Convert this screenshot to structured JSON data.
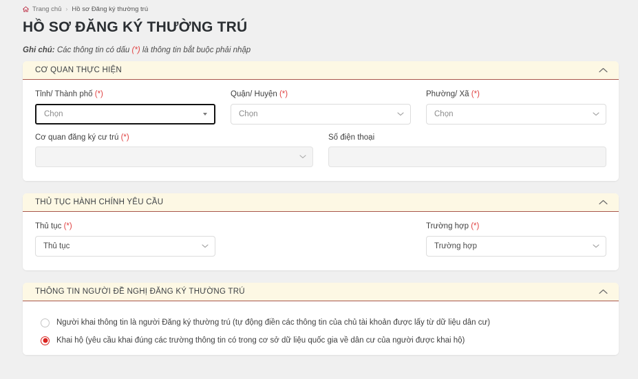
{
  "breadcrumb": {
    "home_icon": "home-icon",
    "home_label": "Trang chủ",
    "separator": "›",
    "current_label": "Hồ sơ Đăng ký thường trú"
  },
  "page_title": "HỒ SƠ ĐĂNG KÝ THƯỜNG TRÚ",
  "note": {
    "prefix": "Ghi chú:",
    "text_before": " Các thông tin có dấu ",
    "required_mark": "(*)",
    "text_after": " là thông tin bắt buộc phải nhập"
  },
  "colors": {
    "page_background": "#f0f0f0",
    "card_background": "#ffffff",
    "section_header_background": "#fdf8e4",
    "section_header_underline": "#a8554a",
    "required_asterisk": "#e04141",
    "radio_selected": "#d9231f",
    "focus_border": "#111111",
    "disabled_field": "#f4f4f4",
    "title_text": "#2b2f33"
  },
  "sections": [
    {
      "id": "co-quan-thuc-hien",
      "title": "CƠ QUAN THỰC HIỆN",
      "collapse_icon": "chevron-up-icon",
      "expanded": true,
      "fields": [
        {
          "id": "tinh-thanh-pho",
          "label": "Tỉnh/ Thành phố",
          "required_mark": "(*)",
          "type": "select",
          "value": "",
          "placeholder": "Chọn",
          "state": "focused",
          "caret_icon": "caret-down-solid-icon"
        },
        {
          "id": "quan-huyen",
          "label": "Quận/ Huyện",
          "required_mark": "(*)",
          "type": "select",
          "value": "",
          "placeholder": "Chọn",
          "state": "default",
          "caret_icon": "chevron-down-icon"
        },
        {
          "id": "phuong-xa",
          "label": "Phường/ Xã",
          "required_mark": "(*)",
          "type": "select",
          "value": "",
          "placeholder": "Chọn",
          "state": "default",
          "caret_icon": "chevron-down-icon"
        },
        {
          "id": "co-quan-dang-ky-cu-tru",
          "label": "Cơ quan đăng ký cư trú",
          "required_mark": "(*)",
          "type": "select",
          "value": "",
          "placeholder": "",
          "state": "disabled",
          "caret_icon": "chevron-down-icon"
        },
        {
          "id": "so-dien-thoai",
          "label": "Số điện thoại",
          "required_mark": "",
          "type": "text",
          "value": "",
          "placeholder": "",
          "state": "disabled",
          "caret_icon": ""
        }
      ]
    },
    {
      "id": "thu-tuc-hanh-chinh-yeu-cau",
      "title": "THỦ TỤC HÀNH CHÍNH YÊU CẦU",
      "collapse_icon": "chevron-up-icon",
      "expanded": true,
      "fields": [
        {
          "id": "thu-tuc",
          "label": "Thủ tục",
          "required_mark": "(*)",
          "type": "select",
          "value": "Thủ tục",
          "placeholder": "Thủ tục",
          "state": "default",
          "caret_icon": "chevron-down-icon"
        },
        {
          "id": "truong-hop",
          "label": "Trường hợp",
          "required_mark": "(*)",
          "type": "select",
          "value": "Trường hợp",
          "placeholder": "Trường hợp",
          "state": "default",
          "caret_icon": "chevron-down-icon"
        }
      ]
    },
    {
      "id": "thong-tin-nguoi-de-nghi",
      "title": "THÔNG TIN NGƯỜI ĐỀ NGHỊ ĐĂNG KÝ THƯỜNG TRÚ",
      "collapse_icon": "chevron-up-icon",
      "expanded": true,
      "radio_group": {
        "name": "loai-nguoi-khai",
        "options": [
          {
            "id": "nguoi-khai-la-nguoi-dang-ky",
            "label": "Người khai thông tin là người Đăng ký thường trú (tự động điền các thông tin của chủ tài khoản được lấy từ dữ liệu dân cư)",
            "selected": false
          },
          {
            "id": "khai-ho",
            "label": "Khai hộ (yêu cầu khai đúng các trường thông tin có trong cơ sở dữ liệu quốc gia về dân cư của người được khai hộ)",
            "selected": true
          }
        ]
      }
    }
  ]
}
